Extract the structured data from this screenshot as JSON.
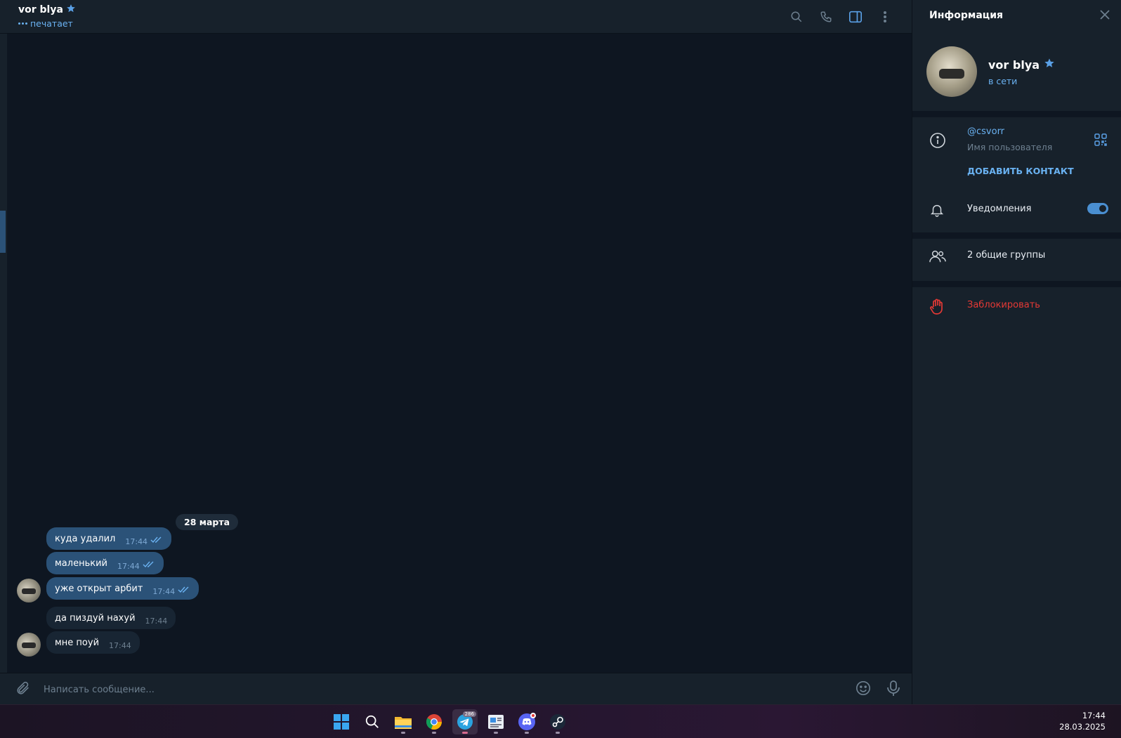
{
  "chat": {
    "title": "vor blya",
    "status": "печатает"
  },
  "messages": {
    "date": "28 марта",
    "items": [
      {
        "text": "куда удалил",
        "time": "17:44",
        "outgoing": true
      },
      {
        "text": "маленький",
        "time": "17:44",
        "outgoing": true
      },
      {
        "text": "уже открыт арбит",
        "time": "17:44",
        "outgoing": true
      },
      {
        "text": "да пиздуй нахуй",
        "time": "17:44",
        "outgoing": false
      },
      {
        "text": "мне поуй",
        "time": "17:44",
        "outgoing": false
      }
    ]
  },
  "composer": {
    "placeholder": "Написать сообщение..."
  },
  "info": {
    "title": "Информация",
    "name": "vor blya",
    "status": "в сети",
    "username": "@csvorr",
    "username_label": "Имя пользователя",
    "add_contact": "ДОБАВИТЬ КОНТАКТ",
    "notifications": "Уведомления",
    "notifications_on": true,
    "groups": "2 общие группы",
    "block": "Заблокировать"
  },
  "taskbar": {
    "apps": [
      "start-icon",
      "search-icon",
      "file-explorer-icon",
      "chrome-icon",
      "telegram-icon",
      "news-icon",
      "discord-icon",
      "steam-icon"
    ],
    "telegram_badge": "286",
    "time": "17:44",
    "date": "28.03.2025"
  },
  "colors": {
    "accent": "#6ab2f2",
    "outgoing_bubble": "#2b5278",
    "incoming_bubble": "#182533",
    "danger": "#e53935"
  }
}
